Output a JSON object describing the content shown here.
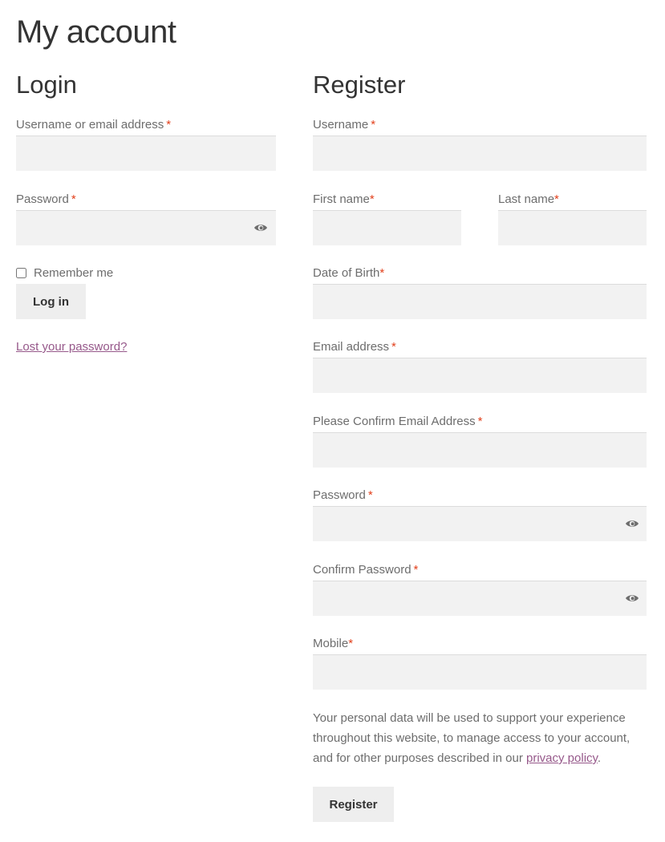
{
  "page": {
    "title": "My account"
  },
  "login": {
    "title": "Login",
    "username_label": "Username or email address",
    "password_label": "Password",
    "required_marker": "*",
    "username_value": "",
    "password_value": "",
    "remember_label": "Remember me",
    "remember_checked": false,
    "submit_label": "Log in",
    "lost_password_link": "Lost your password?"
  },
  "register": {
    "title": "Register",
    "required_marker": "*",
    "fields": {
      "username": {
        "label": "Username",
        "value": ""
      },
      "first_name": {
        "label": "First name",
        "value": ""
      },
      "last_name": {
        "label": "Last name",
        "value": ""
      },
      "dob": {
        "label": "Date of Birth",
        "value": ""
      },
      "email": {
        "label": "Email address",
        "value": ""
      },
      "confirm_email": {
        "label": "Please Confirm Email Address",
        "value": ""
      },
      "password": {
        "label": "Password",
        "value": ""
      },
      "confirm_password": {
        "label": "Confirm Password",
        "value": ""
      },
      "mobile": {
        "label": "Mobile",
        "value": ""
      }
    },
    "privacy_text_before": "Your personal data will be used to support your experience throughout this website, to manage access to your account, and for other purposes described in our ",
    "privacy_link": "privacy policy",
    "privacy_text_after": ".",
    "submit_label": "Register"
  },
  "colors": {
    "accent_link": "#96588a",
    "required": "#e2401c",
    "field_bg": "#f2f2f2",
    "button_bg": "#eeeeee"
  }
}
